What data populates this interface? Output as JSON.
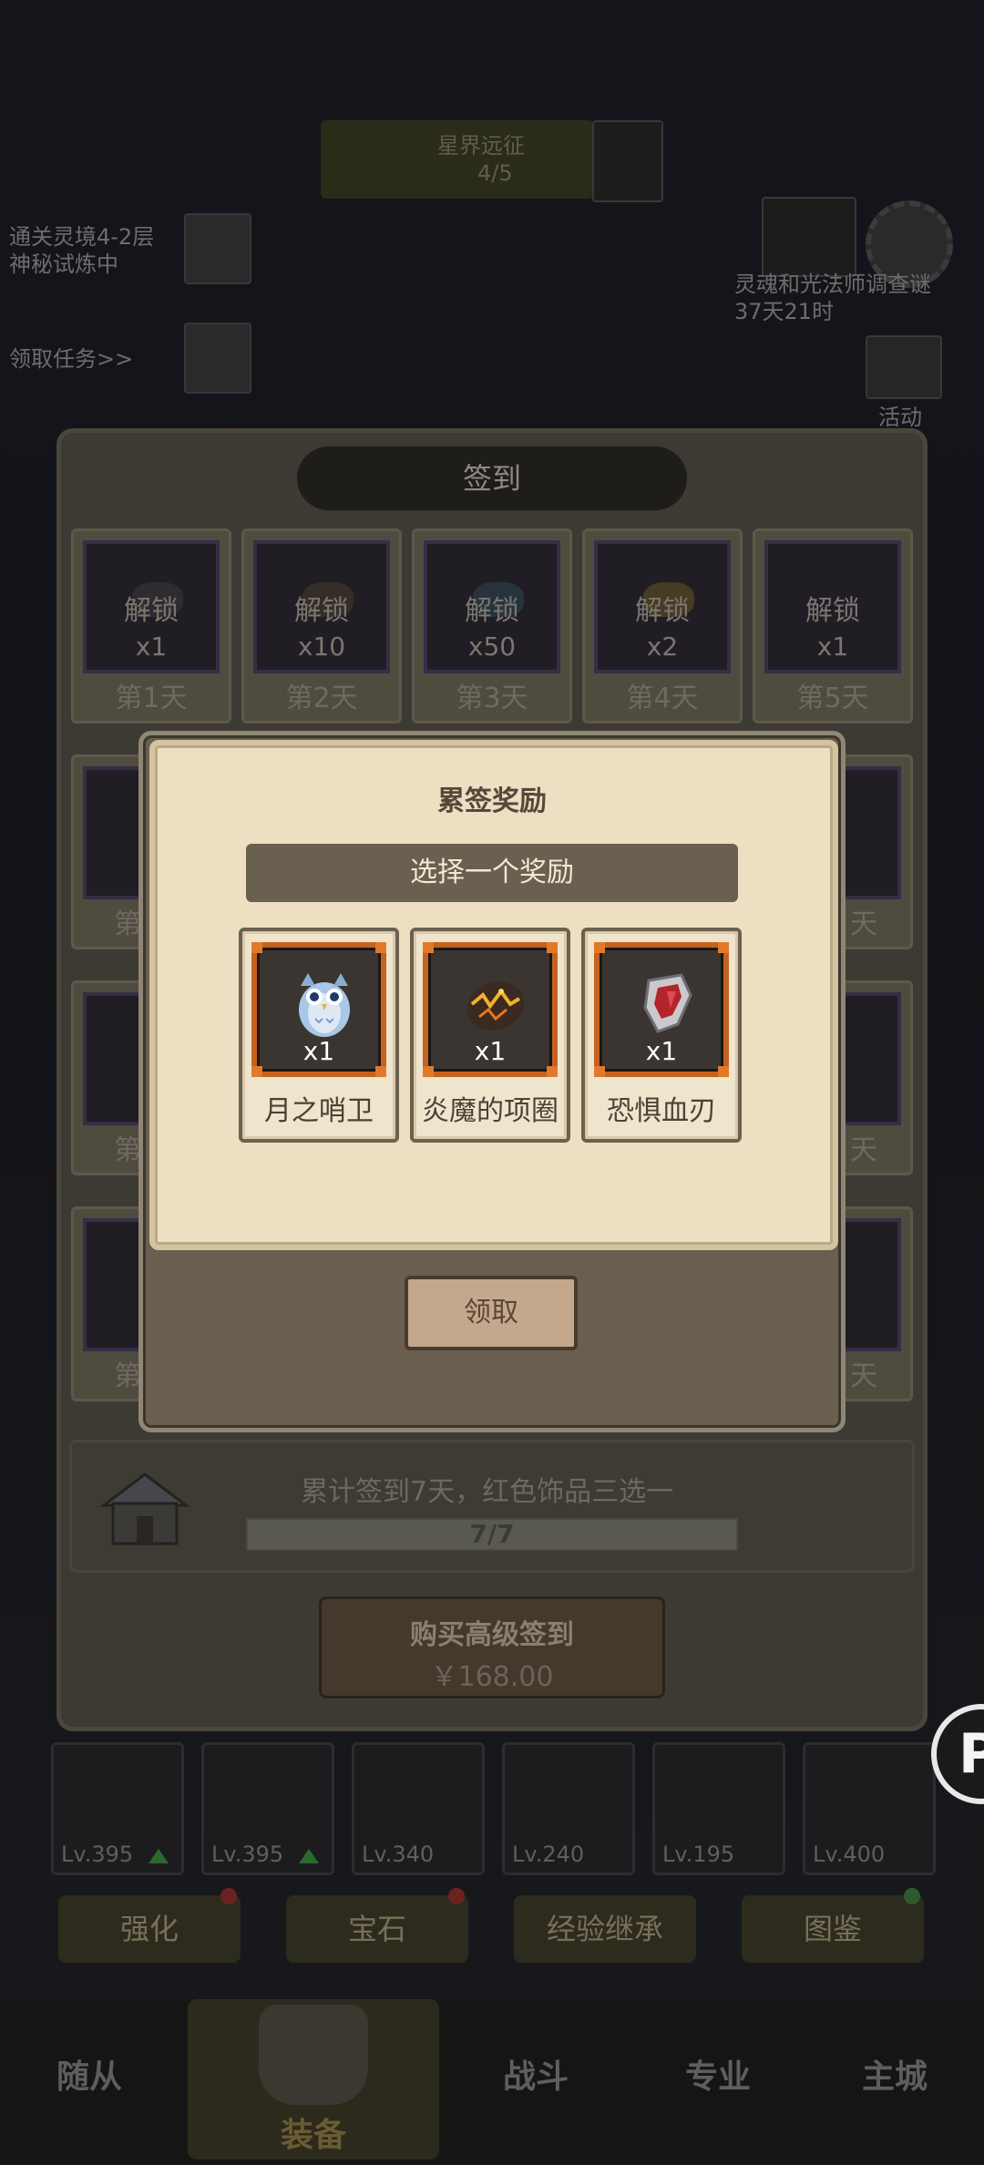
{
  "background": {
    "top_banner": {
      "line1": "星界远征",
      "line2": "4/5"
    },
    "left_items": [
      "通关灵境4-2层",
      "神秘试炼中",
      "领取任务>>"
    ],
    "right_event": {
      "line1": "灵魂和光法师调查谜",
      "line2": "37天21时"
    },
    "activity_label": "活动",
    "equip_slots": [
      {
        "level": "Lv.395",
        "upgrade": true
      },
      {
        "level": "Lv.395",
        "upgrade": true
      },
      {
        "level": "Lv.340",
        "upgrade": false
      },
      {
        "level": "Lv.240",
        "upgrade": false
      },
      {
        "level": "Lv.195",
        "upgrade": false
      },
      {
        "level": "Lv.400",
        "upgrade": false
      }
    ],
    "sub_tabs": [
      "强化",
      "宝石",
      "经验继承",
      "图鉴"
    ],
    "bottom_nav": [
      "随从",
      "装备",
      "战斗",
      "专业",
      "主城"
    ]
  },
  "signin": {
    "title": "签到",
    "days_row1": [
      {
        "label": "第1天",
        "lock": "解锁",
        "count": "x1"
      },
      {
        "label": "第2天",
        "lock": "解锁",
        "count": "x10"
      },
      {
        "label": "第3天",
        "lock": "解锁",
        "count": "x50"
      },
      {
        "label": "第4天",
        "lock": "解锁",
        "count": "x2"
      },
      {
        "label": "第5天",
        "lock": "解锁",
        "count": "x1"
      }
    ],
    "partial_left": "第",
    "partial_right": "天",
    "progress_text": "累计签到7天，红色饰品三选一",
    "progress_value": "7/7",
    "progress_fraction": 1.0,
    "buy_title": "购买高级签到",
    "buy_price": "￥168.00"
  },
  "modal": {
    "title": "累签奖励",
    "subtitle": "选择一个奖励",
    "rewards": [
      {
        "name": "月之哨卫",
        "qty": "x1",
        "icon": "owl-icon"
      },
      {
        "name": "炎魔的项圈",
        "qty": "x1",
        "icon": "lava-collar-icon"
      },
      {
        "name": "恐惧血刃",
        "qty": "x1",
        "icon": "blood-blade-icon"
      }
    ],
    "claim_label": "领取"
  },
  "colors": {
    "modal_parchment": "#ecdfc2",
    "reward_frame": "#c5621f",
    "banner": "#6a6050"
  }
}
